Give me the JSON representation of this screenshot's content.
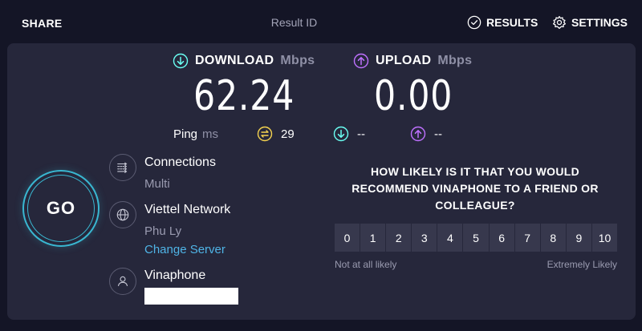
{
  "header": {
    "share_label": "SHARE",
    "result_id_label": "Result ID",
    "results_label": "RESULTS",
    "settings_label": "SETTINGS"
  },
  "download": {
    "label": "DOWNLOAD",
    "unit": "Mbps",
    "value": "62.24",
    "color": "#6afff3"
  },
  "upload": {
    "label": "UPLOAD",
    "unit": "Mbps",
    "value": "0.00",
    "color": "#bf71ff"
  },
  "ping": {
    "label": "Ping",
    "unit": "ms",
    "idle_value": "29",
    "download_value": "--",
    "upload_value": "--",
    "idle_color": "#f5d34f"
  },
  "go_button": {
    "label": "GO",
    "color": "#39b7d1"
  },
  "connections": {
    "title": "Connections",
    "value": "Multi"
  },
  "server": {
    "name": "Viettel Network",
    "location": "Phu Ly",
    "change_label": "Change Server"
  },
  "provider": {
    "name": "Vinaphone"
  },
  "survey": {
    "question": "HOW LIKELY IS IT THAT YOU WOULD RECOMMEND VINAPHONE TO A FRIEND OR COLLEAGUE?",
    "options": [
      "0",
      "1",
      "2",
      "3",
      "4",
      "5",
      "6",
      "7",
      "8",
      "9",
      "10"
    ],
    "low_label": "Not at all likely",
    "high_label": "Extremely Likely"
  }
}
